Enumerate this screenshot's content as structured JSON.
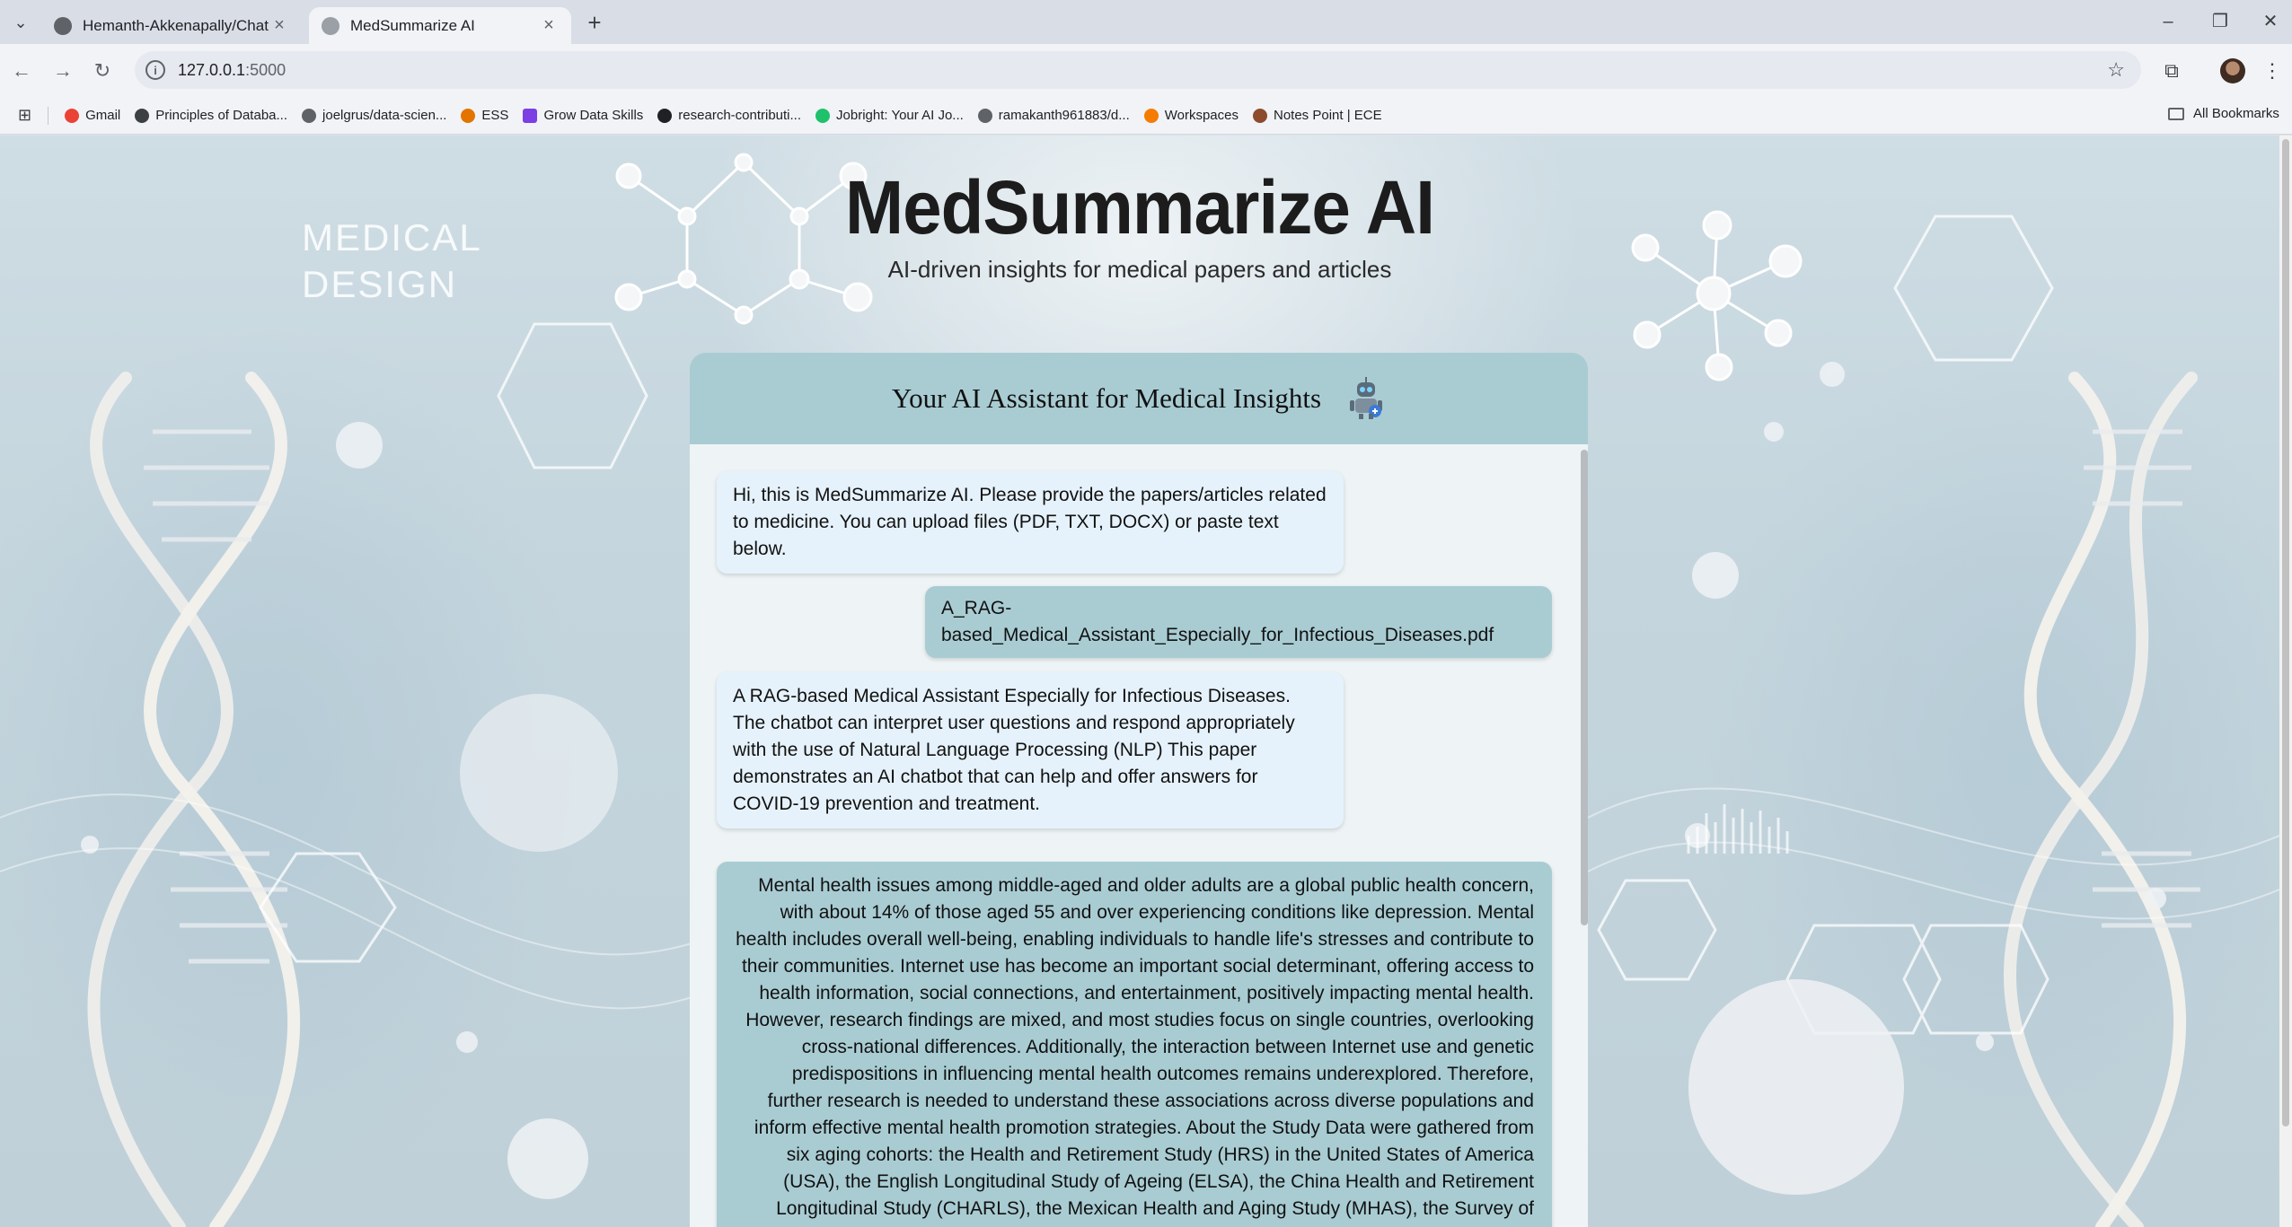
{
  "browser": {
    "tabs": [
      {
        "title": "Hemanth-Akkenapally/Chatbot",
        "active": false
      },
      {
        "title": "MedSummarize AI",
        "active": true
      }
    ],
    "url_host": "127.0.0.1",
    "url_port": ":5000",
    "bookmarks": [
      {
        "label": "Gmail",
        "color": "#ea4335"
      },
      {
        "label": "Principles of Databa...",
        "color": "#3c4043"
      },
      {
        "label": "joelgrus/data-scien...",
        "color": "#5f6368"
      },
      {
        "label": "ESS",
        "color": "#e37400"
      },
      {
        "label": "Grow Data Skills",
        "color": "#7b3fe4"
      },
      {
        "label": "research-contributi...",
        "color": "#202124"
      },
      {
        "label": "Jobright: Your AI Jo...",
        "color": "#1fc16b"
      },
      {
        "label": "ramakanth961883/d...",
        "color": "#5f6368"
      },
      {
        "label": "Workspaces",
        "color": "#f57c00"
      },
      {
        "label": "Notes Point | ECE",
        "color": "#8d4b2c"
      }
    ],
    "all_bookmarks_label": "All Bookmarks"
  },
  "page": {
    "background_text_line1": "MEDICAL",
    "background_text_line2": "DESIGN",
    "title": "MedSummarize AI",
    "subtitle": "AI-driven insights for medical papers and articles",
    "chat": {
      "header_title": "Your AI Assistant for Medical Insights",
      "header_icon": "robot-icon",
      "messages": [
        {
          "role": "bot",
          "text": "Hi, this is MedSummarize AI. Please provide the papers/articles related to medicine. You can upload files (PDF, TXT, DOCX) or paste text below."
        },
        {
          "role": "user",
          "text": "A_RAG-based_Medical_Assistant_Especially_for_Infectious_Diseases.pdf"
        },
        {
          "role": "bot",
          "text": "A RAG-based Medical Assistant Especially for Infectious Diseases. The chatbot can interpret user questions and respond appropriately with the use of Natural Language Processing (NLP) This paper demonstrates an AI chatbot that can help and offer answers for COVID-19 prevention and treatment."
        },
        {
          "role": "user",
          "text": "Mental health issues among middle-aged and older adults are a global public health concern, with about 14% of those aged 55 and over experiencing conditions like depression. Mental health includes overall well-being, enabling individuals to handle life's stresses and contribute to their communities. Internet use has become an important social determinant, offering access to health information, social connections, and entertainment, positively impacting mental health. However, research findings are mixed, and most studies focus on single countries, overlooking cross-national differences. Additionally, the interaction between Internet use and genetic predispositions in influencing mental health outcomes remains underexplored. Therefore, further research is needed to understand these associations across diverse populations and inform effective mental health promotion strategies. About the Study Data were gathered from six aging cohorts: the Health and Retirement Study (HRS) in the United States of America (USA), the English Longitudinal Study of Ageing (ELSA), the China Health and Retirement Longitudinal Study (CHARLS), the Mexican Health and Aging Study (MHAS), the Survey of Health, Ageing and Retirement in Europe (SHARE), and the"
        }
      ]
    }
  },
  "colors": {
    "header_bg": "#a9ccd3",
    "bot_bubble": "#e6f2fb",
    "user_bubble": "#a9ccd3",
    "chat_bg": "#eef4f6"
  }
}
